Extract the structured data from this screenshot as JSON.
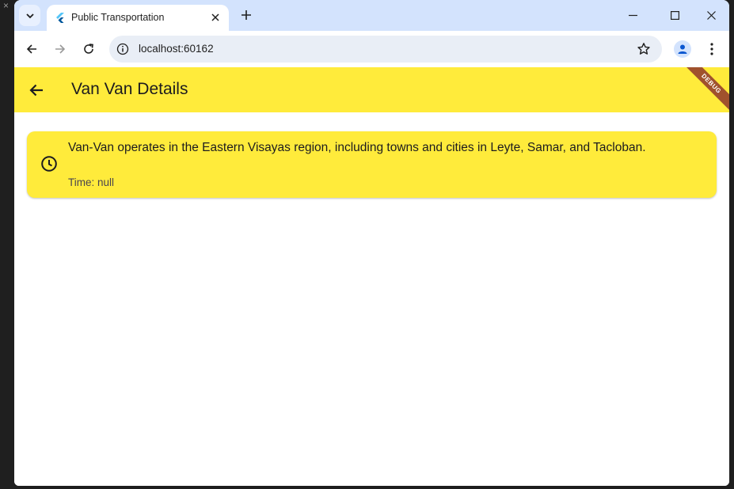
{
  "browser": {
    "tab": {
      "title": "Public Transportation"
    },
    "address": {
      "url": "localhost:60162"
    }
  },
  "app": {
    "appbar": {
      "title": "Van Van Details",
      "debug_banner": "DEBUG",
      "color": "#ffeb3b"
    },
    "card": {
      "description": "Van-Van operates in the Eastern Visayas region, including towns and cities in Leyte, Samar, and Tacloban.",
      "time": "Time: null",
      "icon": "clock-icon"
    }
  }
}
